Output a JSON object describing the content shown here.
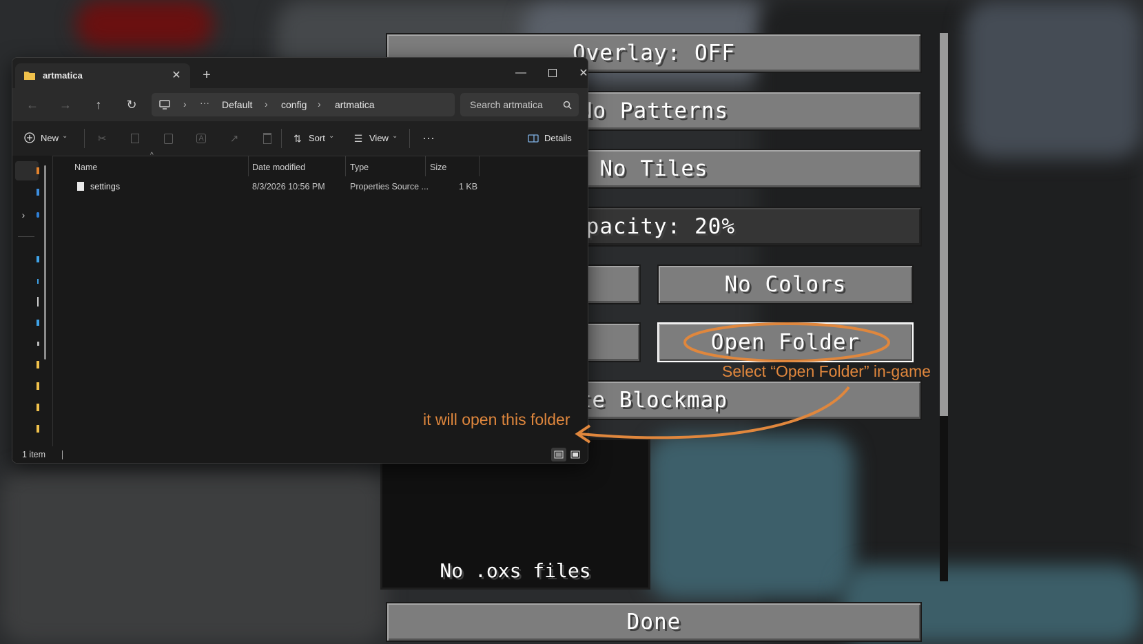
{
  "colors": {
    "accent": "#e0873d",
    "folder": "#f0c14b"
  },
  "minecraft": {
    "buttons": {
      "overlay": "Overlay: OFF",
      "patterns": "No Patterns",
      "tiles": "No Tiles",
      "opacity": "Opacity: 20%",
      "colors": "No Colors",
      "open_folder": "Open Folder",
      "generate": "Generate Blockmap",
      "done": "Done"
    },
    "empty_list": "No .oxs files"
  },
  "explorer": {
    "tab_title": "artmatica",
    "breadcrumb": [
      "Default",
      "config",
      "artmatica"
    ],
    "search_placeholder": "Search artmatica",
    "toolbar": {
      "new": "New",
      "sort": "Sort",
      "view": "View",
      "details": "Details"
    },
    "columns": [
      "Name",
      "Date modified",
      "Type",
      "Size"
    ],
    "files": [
      {
        "name": "settings",
        "date": "8/3/2026 10:56 PM",
        "type": "Properties Source ...",
        "size": "1 KB"
      }
    ],
    "status": "1 item"
  },
  "annotations": {
    "select": "Select “Open Folder” in-game",
    "opens": "it will open this folder"
  }
}
